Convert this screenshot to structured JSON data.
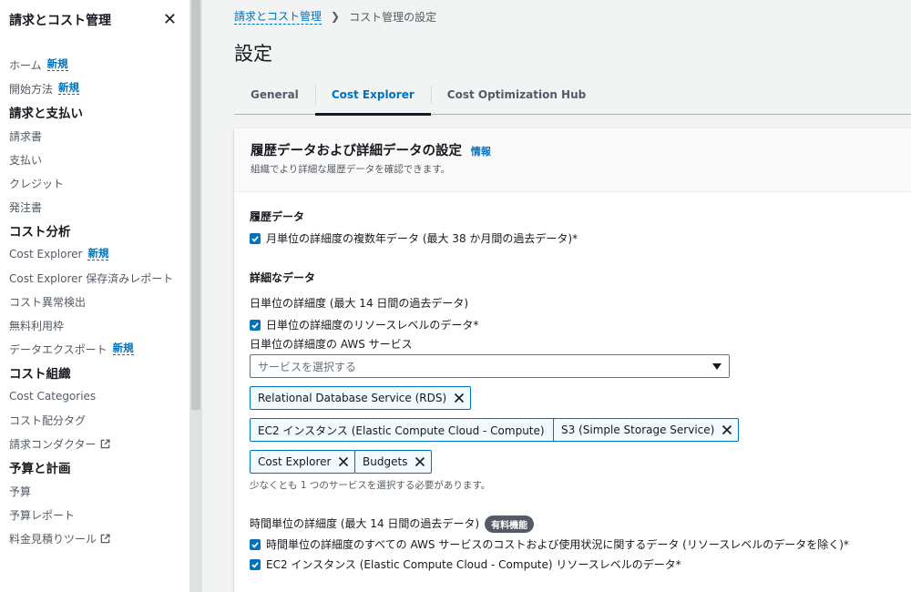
{
  "sidebar": {
    "title": "請求とコスト管理",
    "new_badge": "新規",
    "items": [
      {
        "kind": "item",
        "label": "ホーム",
        "new": true
      },
      {
        "kind": "item",
        "label": "開始方法",
        "new": true
      },
      {
        "kind": "section",
        "label": "請求と支払い"
      },
      {
        "kind": "item",
        "label": "請求書"
      },
      {
        "kind": "item",
        "label": "支払い"
      },
      {
        "kind": "item",
        "label": "クレジット"
      },
      {
        "kind": "item",
        "label": "発注書"
      },
      {
        "kind": "section",
        "label": "コスト分析"
      },
      {
        "kind": "item",
        "label": "Cost Explorer",
        "new": true
      },
      {
        "kind": "item",
        "label": "Cost Explorer 保存済みレポート"
      },
      {
        "kind": "item",
        "label": "コスト異常検出"
      },
      {
        "kind": "item",
        "label": "無料利用枠"
      },
      {
        "kind": "item",
        "label": "データエクスポート",
        "new": true
      },
      {
        "kind": "section",
        "label": "コスト組織"
      },
      {
        "kind": "item",
        "label": "Cost Categories"
      },
      {
        "kind": "item",
        "label": "コスト配分タグ"
      },
      {
        "kind": "item",
        "label": "請求コンダクター",
        "external": true
      },
      {
        "kind": "section",
        "label": "予算と計画"
      },
      {
        "kind": "item",
        "label": "予算"
      },
      {
        "kind": "item",
        "label": "予算レポート"
      },
      {
        "kind": "item",
        "label": "料金見積りツール",
        "external": true
      }
    ]
  },
  "breadcrumb": {
    "parent": "請求とコスト管理",
    "current": "コスト管理の設定"
  },
  "page_title": "設定",
  "tabs": [
    {
      "label": "General",
      "active": false
    },
    {
      "label": "Cost Explorer",
      "active": true
    },
    {
      "label": "Cost Optimization Hub",
      "active": false
    }
  ],
  "panel": {
    "title": "履歴データおよび詳細データの設定",
    "info": "情報",
    "description": "組織でより詳細な履歴データを確認できます。",
    "history_heading": "履歴データ",
    "history_check": "月単位の詳細度の複数年データ (最大 38 か月間の過去データ)*",
    "detail_heading": "詳細なデータ",
    "daily_label": "日単位の詳細度 (最大 14 日間の過去データ)",
    "daily_check": "日単位の詳細度のリソースレベルのデータ*",
    "daily_services_label": "日単位の詳細度の AWS サービス",
    "select_placeholder": "サービスを選択する",
    "tokens": [
      "Relational Database Service (RDS)",
      "EC2 インスタンス (Elastic Compute Cloud - Compute)",
      "S3 (Simple Storage Service)",
      "Cost Explorer",
      "Budgets"
    ],
    "hint": "少なくとも 1 つのサービスを選択する必要があります。",
    "hourly_label": "時間単位の詳細度 (最大 14 日間の過去データ)",
    "paid_badge": "有料機能",
    "hourly_check_1": "時間単位の詳細度のすべての AWS サービスのコストおよび使用状況に関するデータ (リソースレベルのデータを除く)*",
    "hourly_check_2": "EC2 インスタンス (Elastic Compute Cloud - Compute) リソースレベルのデータ*"
  },
  "colors": {
    "accent": "#0073bb",
    "text": "#16191f",
    "muted": "#545b64",
    "background": "#f2f3f3"
  }
}
